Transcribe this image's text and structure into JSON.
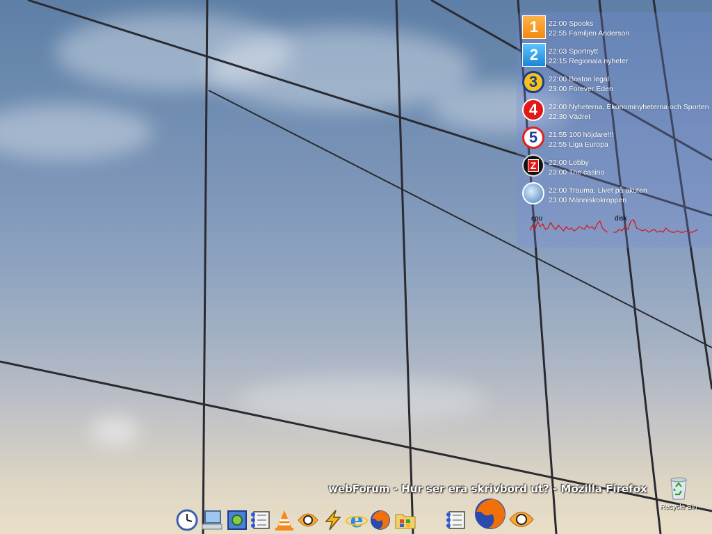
{
  "tv_guide": [
    {
      "channel": "1",
      "line1": "22:00 Spooks",
      "line2": "22:55 Familjen Anderson"
    },
    {
      "channel": "2",
      "line1": "22:03 Sportnytt",
      "line2": "22:15 Regionala nyheter"
    },
    {
      "channel": "3",
      "line1": "22:00 Boston legal",
      "line2": "23:00 Forever Eden"
    },
    {
      "channel": "4",
      "line1": "22:00 Nyheterna, Ekonominyheterna och Sporten",
      "line2": "22:30 Vädret"
    },
    {
      "channel": "5",
      "line1": "21:55 100 höjdare!!!",
      "line2": "22:55 Liga Europa"
    },
    {
      "channel": "Z",
      "line1": "22:00 Lobby",
      "line2": "23:00 The casino"
    },
    {
      "channel": "",
      "line1": "22:00 Trauma: Livet på akuten",
      "line2": "23:00 Människokroppen"
    }
  ],
  "monitors": {
    "cpu_label": "cpu",
    "disk_label": "disk",
    "cpu_values": [
      0.2,
      0.6,
      0.3,
      0.9,
      0.5,
      0.7,
      0.3,
      0.4,
      0.8,
      0.5,
      0.3,
      0.6,
      0.4,
      0.2,
      0.5,
      0.3,
      0.4,
      0.2,
      0.3,
      0.5,
      0.4,
      0.3,
      0.6,
      0.4,
      0.5,
      0.3,
      0.7,
      0.9,
      0.4,
      0.2,
      0.1
    ],
    "disk_values": [
      0.1,
      0.1,
      0.3,
      0.2,
      0.5,
      0.3,
      0.9,
      1.0,
      0.4,
      0.3,
      0.2,
      0.3,
      0.1,
      0.2,
      0.3,
      0.1,
      0.2,
      0.1,
      0.4,
      0.2,
      0.1,
      0.1,
      0.2,
      0.1,
      0.1,
      0.2,
      0.1,
      0.1,
      0.2,
      0.3
    ],
    "line_color": "#e01010"
  },
  "window_title": "webForum - Hur ser era skrivbord ut? - Mozilla Firefox",
  "dock": [
    {
      "name": "clock-icon"
    },
    {
      "name": "my-computer-icon"
    },
    {
      "name": "control-panel-icon"
    },
    {
      "name": "task-manager-icon"
    },
    {
      "name": "vlc-icon"
    },
    {
      "name": "media-player-icon"
    },
    {
      "name": "winamp-icon"
    },
    {
      "name": "internet-explorer-icon"
    },
    {
      "name": "firefox-icon"
    },
    {
      "name": "explorer-folder-icon"
    },
    {
      "name": "running-task-manager-icon"
    },
    {
      "name": "running-firefox-icon"
    },
    {
      "name": "running-media-player-icon"
    }
  ],
  "recycle_bin_label": "Recycle Bin"
}
